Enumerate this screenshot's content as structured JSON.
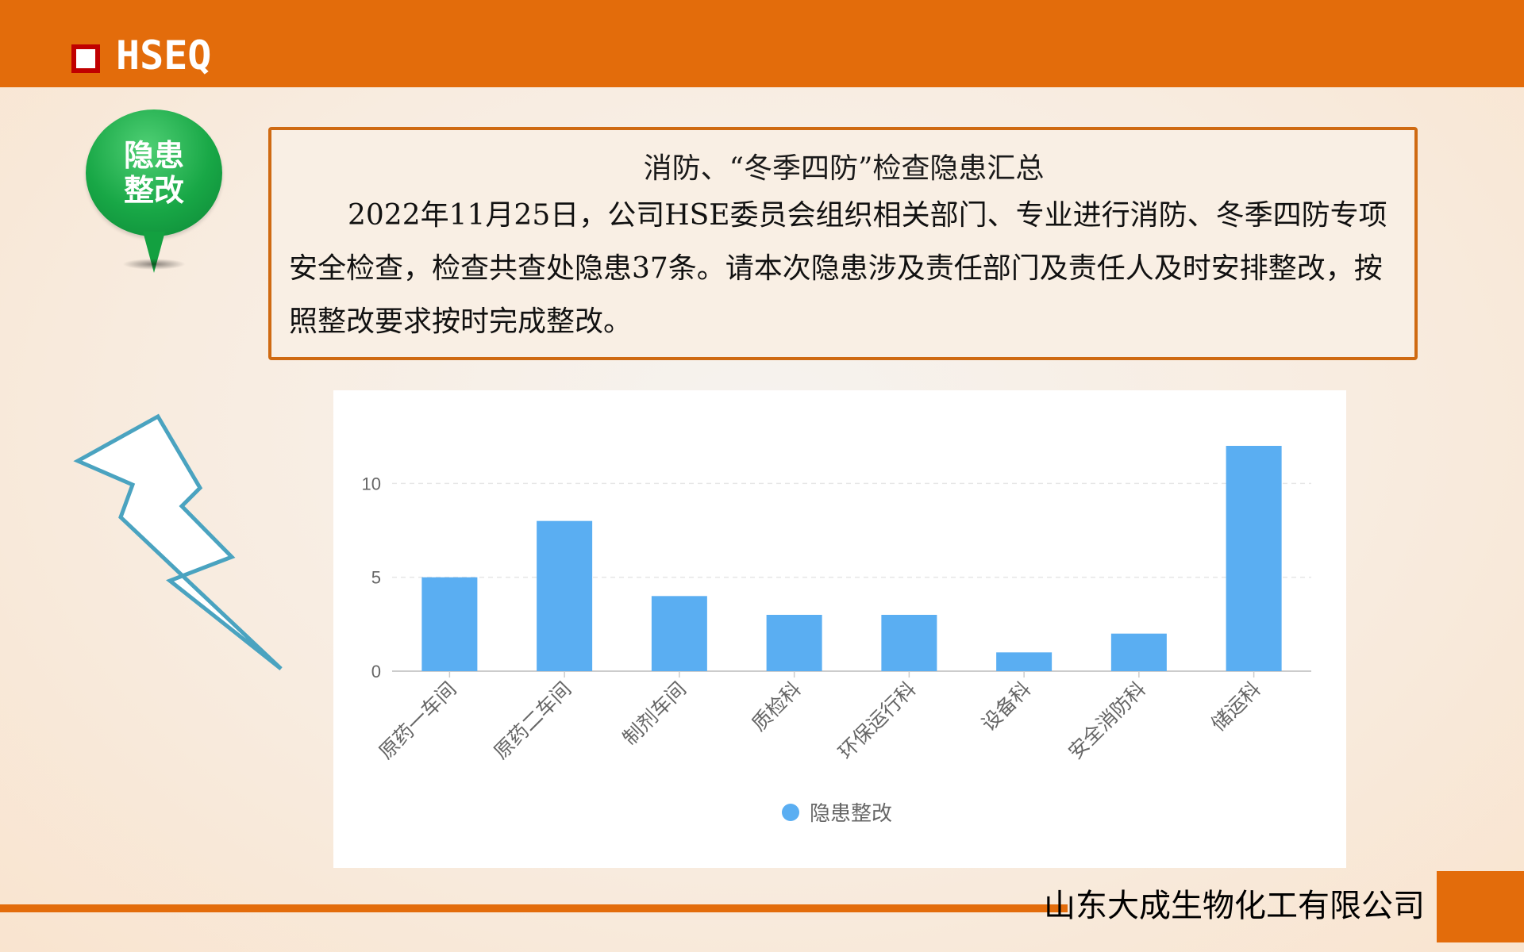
{
  "header": {
    "title": "HSEQ"
  },
  "badge": {
    "text": "隐患整改"
  },
  "notice": {
    "title": "消防、“冬季四防”检查隐患汇总",
    "body": "2022年11月25日，公司HSE委员会组织相关部门、专业进行消防、冬季四防专项安全检查，检查共查处隐患37条。请本次隐患涉及责任部门及责任人及时安排整改，按照整改要求按时完成整改。"
  },
  "footer": {
    "company": "山东大成生物化工有限公司"
  },
  "colors": {
    "accent": "#e36c0b",
    "bar": "#5aaef2",
    "badge": "#18a746",
    "bolt_stroke": "#4aa3c0"
  },
  "chart_data": {
    "type": "bar",
    "categories": [
      "原药一车间",
      "原药二车间",
      "制剂车间",
      "质检科",
      "环保运行科",
      "设备科",
      "安全消防科",
      "储运科"
    ],
    "series": [
      {
        "name": "隐患整改",
        "values": [
          5,
          8,
          4,
          3,
          3,
          1,
          2,
          12
        ]
      }
    ],
    "yticks": [
      0,
      5,
      10
    ],
    "ylim": [
      0,
      12
    ],
    "legend": "bottom",
    "grid": "dashed horizontal"
  }
}
